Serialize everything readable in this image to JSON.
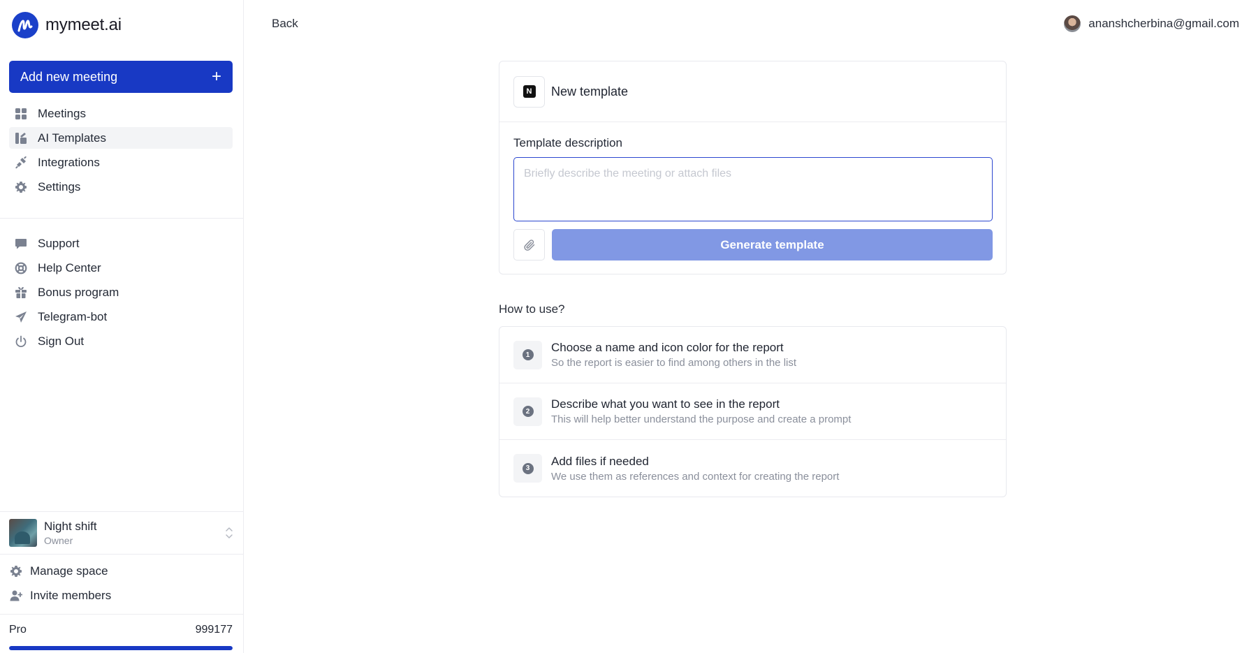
{
  "app": {
    "name": "mymeet.ai"
  },
  "sidebar": {
    "add_button_label": "Add new meeting",
    "add_button_icon": "+",
    "primary_items": [
      {
        "label": "Meetings",
        "icon": "grid-icon",
        "active": false
      },
      {
        "label": "AI Templates",
        "icon": "templates-icon",
        "active": true
      },
      {
        "label": "Integrations",
        "icon": "plug-icon",
        "active": false
      },
      {
        "label": "Settings",
        "icon": "gear-icon",
        "active": false
      }
    ],
    "secondary_items": [
      {
        "label": "Support",
        "icon": "chat-icon"
      },
      {
        "label": "Help Center",
        "icon": "lifebuoy-icon"
      },
      {
        "label": "Bonus program",
        "icon": "gift-icon"
      },
      {
        "label": "Telegram-bot",
        "icon": "send-icon"
      },
      {
        "label": "Sign Out",
        "icon": "power-icon"
      }
    ],
    "workspace": {
      "name": "Night shift",
      "role": "Owner"
    },
    "workspace_items": [
      {
        "label": "Manage space",
        "icon": "gear-icon"
      },
      {
        "label": "Invite members",
        "icon": "user-plus-icon"
      }
    ],
    "plan": {
      "name": "Pro",
      "count": "999177",
      "progress_percent": 100
    }
  },
  "header": {
    "back_label": "Back",
    "user_email": "ananshcherbina@gmail.com"
  },
  "template_card": {
    "title": "New template",
    "description_label": "Template description",
    "description_placeholder": "Briefly describe the meeting or attach files",
    "description_value": "",
    "generate_label": "Generate template"
  },
  "how_to": {
    "heading": "How to use?",
    "steps": [
      {
        "number": "1",
        "title": "Choose a name and icon color for the report",
        "subtitle": "So the report is easier to find among others in the list"
      },
      {
        "number": "2",
        "title": "Describe what you want to see in the report",
        "subtitle": "This will help better understand the purpose and create a prompt"
      },
      {
        "number": "3",
        "title": "Add files if needed",
        "subtitle": "We use them as references and context for creating the report"
      }
    ]
  },
  "colors": {
    "brand": "#1839c4",
    "generate_disabled": "#8198e4",
    "input_border": "#2b47cf"
  }
}
